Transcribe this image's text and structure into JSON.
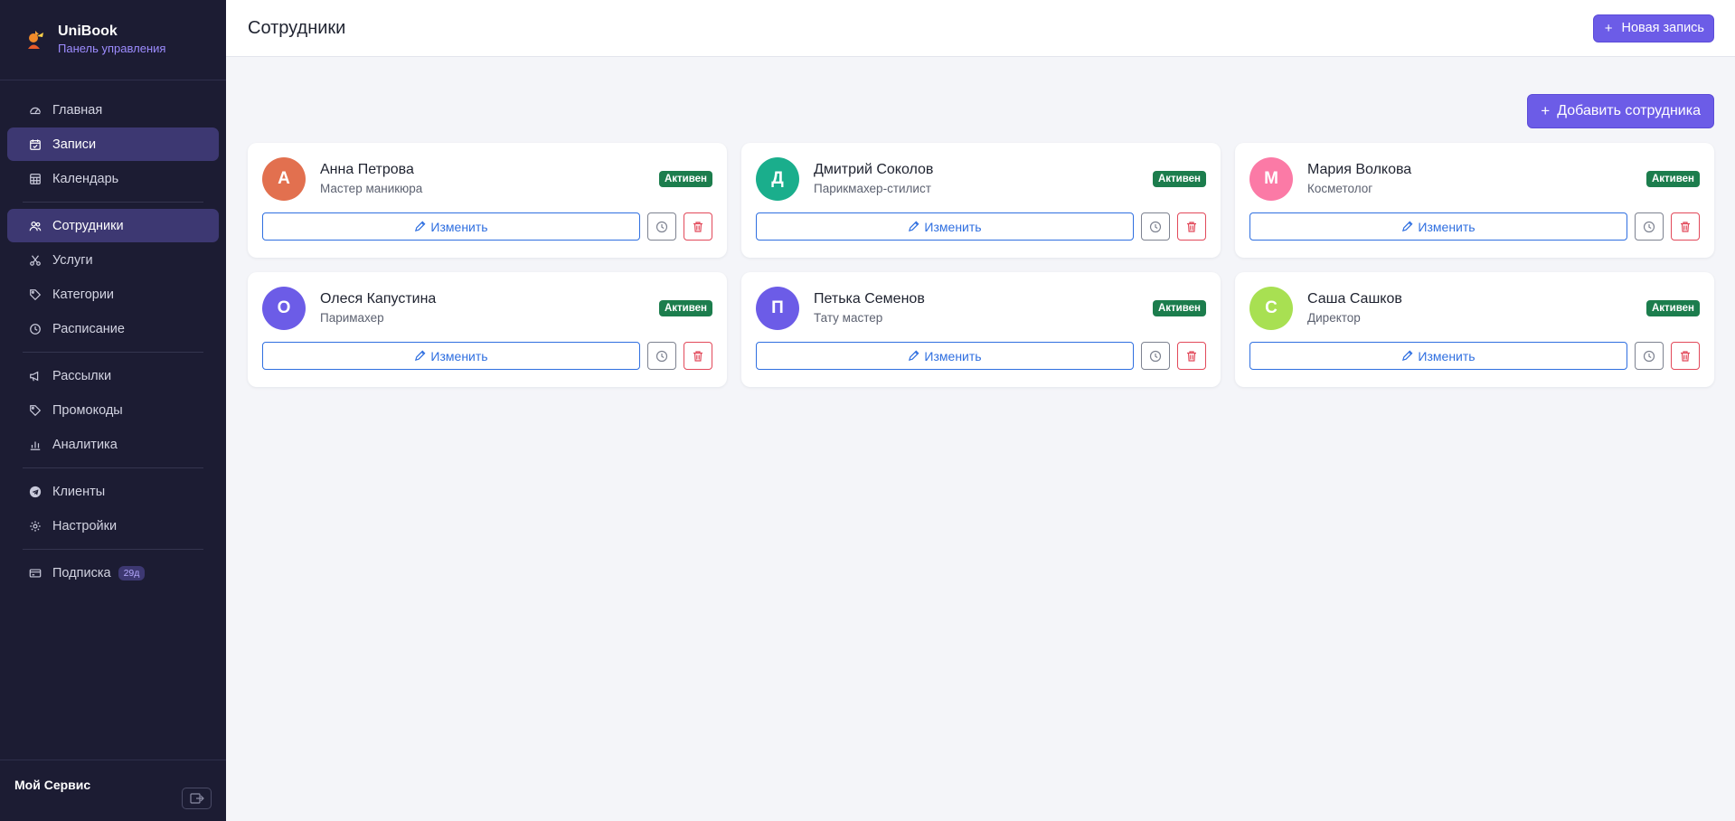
{
  "brand": {
    "title": "UniBook",
    "subtitle": "Панель управления"
  },
  "header": {
    "title": "Сотрудники",
    "new_button": "Новая запись"
  },
  "add_employee_button": "Добавить сотрудника",
  "nav": [
    {
      "label": "Главная",
      "icon": "dashboard-icon"
    },
    {
      "label": "Записи",
      "icon": "calendar-check-icon",
      "active": true
    },
    {
      "label": "Календарь",
      "icon": "calendar-grid-icon"
    },
    {
      "label": "Сотрудники",
      "icon": "people-icon",
      "active": true
    },
    {
      "label": "Услуги",
      "icon": "scissors-icon"
    },
    {
      "label": "Категории",
      "icon": "tags-icon"
    },
    {
      "label": "Расписание",
      "icon": "clock-icon"
    },
    {
      "label": "Рассылки",
      "icon": "megaphone-icon"
    },
    {
      "label": "Промокоды",
      "icon": "tag-icon"
    },
    {
      "label": "Аналитика",
      "icon": "bar-chart-icon"
    },
    {
      "label": "Клиенты",
      "icon": "telegram-icon"
    },
    {
      "label": "Настройки",
      "icon": "gear-icon"
    },
    {
      "label": "Подписка",
      "icon": "credit-card-icon",
      "badge": "29д"
    }
  ],
  "footer": {
    "name": "Мой Сервис"
  },
  "employees": [
    {
      "initial": "А",
      "name": "Анна Петрова",
      "role": "Мастер маникюра",
      "status": "Активен",
      "color": "#e2704f"
    },
    {
      "initial": "Д",
      "name": "Дмитрий Соколов",
      "role": "Парикмахер-стилист",
      "status": "Активен",
      "color": "#1aae8c"
    },
    {
      "initial": "М",
      "name": "Мария Волкова",
      "role": "Косметолог",
      "status": "Активен",
      "color": "#fb7aa6"
    },
    {
      "initial": "О",
      "name": "Олеся Капустина",
      "role": "Паримахер",
      "status": "Активен",
      "color": "#6c5ce7"
    },
    {
      "initial": "П",
      "name": "Петька Семенов",
      "role": "Тату мастер",
      "status": "Активен",
      "color": "#6c5ce7"
    },
    {
      "initial": "С",
      "name": "Саша Сашков",
      "role": "Директор",
      "status": "Активен",
      "color": "#a8e052"
    }
  ],
  "edit_label": "Изменить",
  "colors": {
    "sidebar": "#1c1c33",
    "accent": "#6c5ce7",
    "active_badge": "#1c7d4d",
    "edit_blue": "#2f6fe0",
    "delete_red": "#e2495a"
  }
}
